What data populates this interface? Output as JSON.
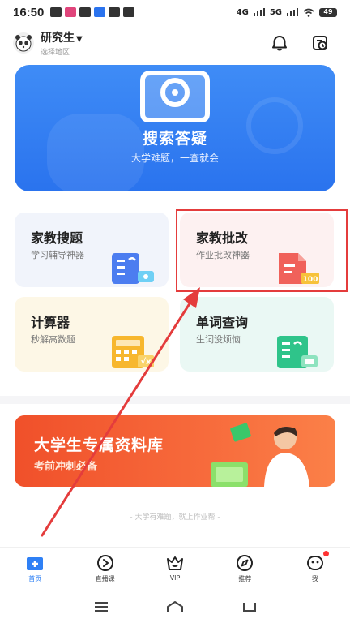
{
  "status_bar": {
    "time": "16:50",
    "network": "4G",
    "network2": "5G",
    "battery": "49"
  },
  "header": {
    "user_name": "研究生",
    "region_hint": "选择地区"
  },
  "banner": {
    "title": "搜索答疑",
    "subtitle": "大学难题，一查就会"
  },
  "tools": [
    {
      "title": "家教搜题",
      "subtitle": "学习辅导神器",
      "icon": "search-doc-icon"
    },
    {
      "title": "家教批改",
      "subtitle": "作业批改神器",
      "icon": "grade-100-icon"
    },
    {
      "title": "计算器",
      "subtitle": "秒解高数题",
      "icon": "calculator-icon"
    },
    {
      "title": "单词查询",
      "subtitle": "生词没烦恼",
      "icon": "word-lookup-icon"
    }
  ],
  "promo": {
    "title": "大学生专属资料库",
    "subtitle": "考前冲刺必备"
  },
  "slogan": "- 大学有难题，就上作业帮 -",
  "bottom_nav": [
    {
      "label": "首页",
      "icon": "home-icon",
      "active": true
    },
    {
      "label": "直播课",
      "icon": "play-icon",
      "active": false
    },
    {
      "label": "VIP",
      "icon": "vip-crown-icon",
      "active": false
    },
    {
      "label": "推荐",
      "icon": "compass-icon",
      "active": false
    },
    {
      "label": "我",
      "icon": "profile-icon",
      "active": false
    }
  ],
  "colors": {
    "primary_blue": "#2f80f5",
    "promo_orange": "#f0502a",
    "annotation_red": "#e43c3c"
  }
}
